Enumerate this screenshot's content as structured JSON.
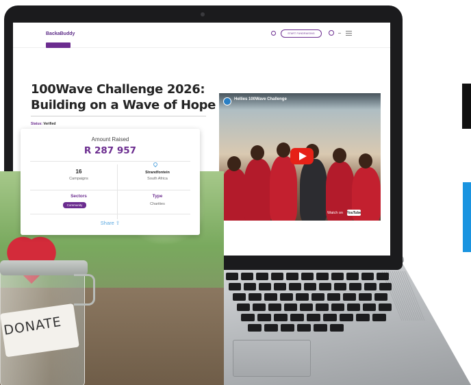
{
  "site": {
    "logo": "BackaBuddy",
    "start_button": "START FUNDRAISING"
  },
  "campaign": {
    "title": "100Wave Challenge 2026: Building on a Wave of Hope",
    "status_label": "Status:",
    "status_value": "Verified"
  },
  "card": {
    "amount_label": "Amount Raised",
    "amount": "R 287 957",
    "campaigns_count": "16",
    "campaigns_label": "Campaigns",
    "place": "Strandfontein",
    "country": "South Africa",
    "sectors_label": "Sectors",
    "sector_tag": "Community",
    "type_label": "Type",
    "type_value": "Charities",
    "share_label": "Share"
  },
  "video": {
    "title": "Hellies 100Wave Challenge",
    "watch_label": "Watch on",
    "yt_label": "YouTube"
  },
  "photo": {
    "label_text": "DONATE"
  },
  "colors": {
    "brand": "#6b2c8f",
    "accent_blue": "#1a94e0",
    "play_red": "#e62117"
  }
}
